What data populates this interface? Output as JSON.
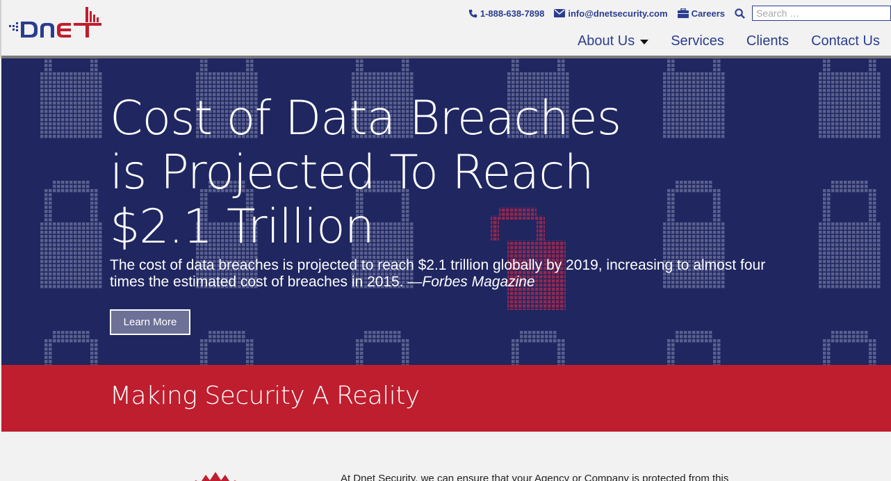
{
  "header": {
    "logo_text": "Dnet",
    "phone": "1-888-638-7898",
    "email": "info@dnetsecurity.com",
    "careers": "Careers",
    "search_placeholder": "Search …",
    "icons": [
      "phone-icon",
      "envelope-icon",
      "briefcase-icon",
      "search-icon"
    ]
  },
  "nav": {
    "items": [
      {
        "label": "About Us",
        "dropdown": true
      },
      {
        "label": "Services"
      },
      {
        "label": "Clients"
      },
      {
        "label": "Contact Us"
      }
    ]
  },
  "hero": {
    "title": "Cost of Data Breaches is Projected To Reach $2.1 Trillion",
    "subtitle": "The cost of data breaches is projected to reach $2.1 trillion globally by 2019, increasing to almost four times the estimated cost of breaches in 2015. ",
    "source": "—Forbes Magazine",
    "button": "Learn More"
  },
  "band": {
    "title": "Making Security A Reality"
  },
  "content": {
    "intro": "At Dnet Security, we can ensure that your Agency or Company is protected from this"
  },
  "colors": {
    "brand_blue": "#2a3d8f",
    "brand_red": "#bf1e2e",
    "hero_bg": "#1f2660"
  }
}
